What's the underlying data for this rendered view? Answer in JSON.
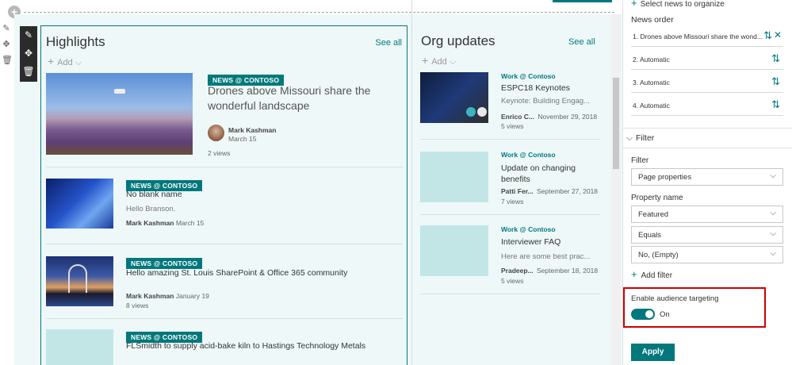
{
  "highlights": {
    "title": "Highlights",
    "see_all": "See all",
    "add": "Add",
    "featured": {
      "badge": "NEWS @ CONTOSO",
      "title": "Drones above Missouri share the wonderful landscape",
      "author": "Mark Kashman",
      "date": "March 15",
      "views": "2 views"
    },
    "items": [
      {
        "badge": "NEWS @ CONTOSO",
        "title": "No blank name",
        "desc": "Hello Branson.",
        "author": "Mark Kashman",
        "date": "March 15",
        "views": ""
      },
      {
        "badge": "NEWS @ CONTOSO",
        "title": "Hello amazing St. Louis SharePoint & Office 365 community",
        "desc": "",
        "author": "Mark Kashman",
        "date": "January 19",
        "views": "8 views"
      },
      {
        "badge": "NEWS @ CONTOSO",
        "title": "FLSmidth to supply acid-bake kiln to Hastings Technology Metals",
        "desc": "",
        "author": "",
        "date": "",
        "views": ""
      }
    ]
  },
  "org": {
    "title": "Org updates",
    "see_all": "See all",
    "add": "Add",
    "items": [
      {
        "site": "Work @ Contoso",
        "title": "ESPC18 Keynotes",
        "desc": "Keynote: Building Engag...",
        "author": "Enrico C...",
        "date": "November 29, 2018",
        "views": "5 views"
      },
      {
        "site": "Work @ Contoso",
        "title": "Update on changing benefits",
        "desc": "",
        "author": "Patti Fer...",
        "date": "September 27, 2018",
        "views": "7 views"
      },
      {
        "site": "Work @ Contoso",
        "title": "Interviewer FAQ",
        "desc": "Here are some best prac...",
        "author": "Pradeep...",
        "date": "September 18, 2018",
        "views": "5 views"
      }
    ]
  },
  "pane": {
    "select_news": "Select news to organize",
    "news_order": "News order",
    "order_items": [
      "1.  Drones above Missouri share the wond...",
      "2.  Automatic",
      "3.  Automatic",
      "4.  Automatic"
    ],
    "filter_section": "Filter",
    "filter_label": "Filter",
    "filter_value": "Page properties",
    "property_label": "Property name",
    "property_value": "Featured",
    "operator_value": "Equals",
    "value_value": "No, (Empty)",
    "add_filter": "Add filter",
    "audience_label": "Enable audience targeting",
    "audience_state": "On",
    "apply": "Apply"
  },
  "colors": {
    "accent": "#03787c",
    "highlight_border": "#cc0000"
  }
}
